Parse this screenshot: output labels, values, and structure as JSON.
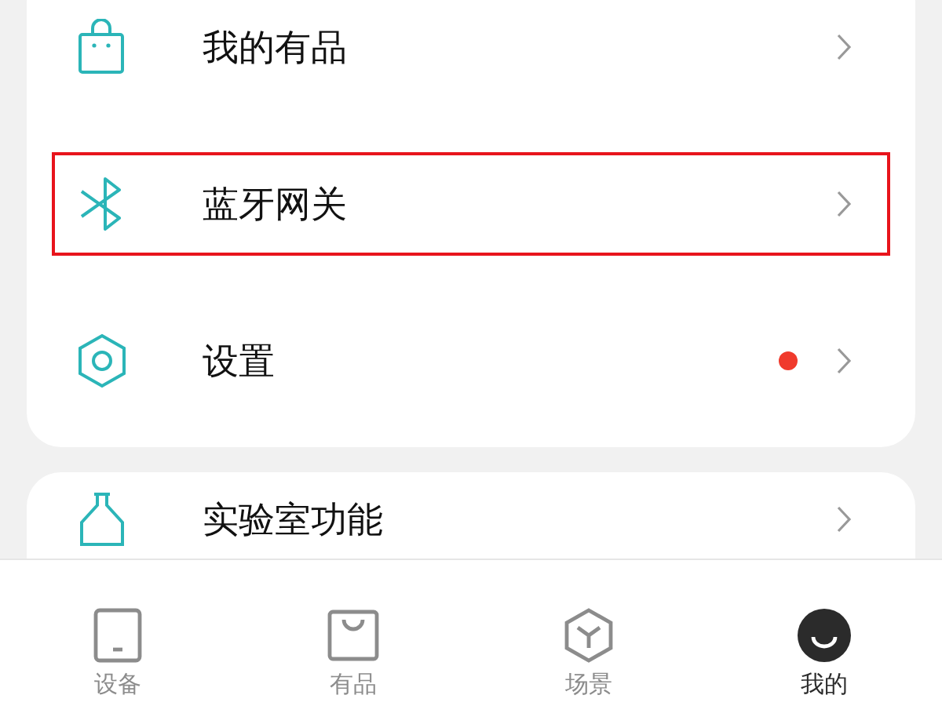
{
  "menu_card": {
    "items": [
      {
        "kind": "bag",
        "label": "我的有品",
        "highlighted": false,
        "dot": false
      },
      {
        "kind": "bluetooth",
        "label": "蓝牙网关",
        "highlighted": true,
        "dot": false
      },
      {
        "kind": "hexagon",
        "label": "设置",
        "highlighted": false,
        "dot": true
      }
    ]
  },
  "lab_card": {
    "items": [
      {
        "kind": "flask",
        "label": "实验室功能"
      }
    ]
  },
  "tab_bar": {
    "tabs": [
      {
        "kind": "device",
        "label": "设备",
        "selected": false
      },
      {
        "kind": "store",
        "label": "有品",
        "selected": false
      },
      {
        "kind": "scene",
        "label": "场景",
        "selected": false
      },
      {
        "kind": "profile",
        "label": "我的",
        "selected": true
      }
    ]
  }
}
